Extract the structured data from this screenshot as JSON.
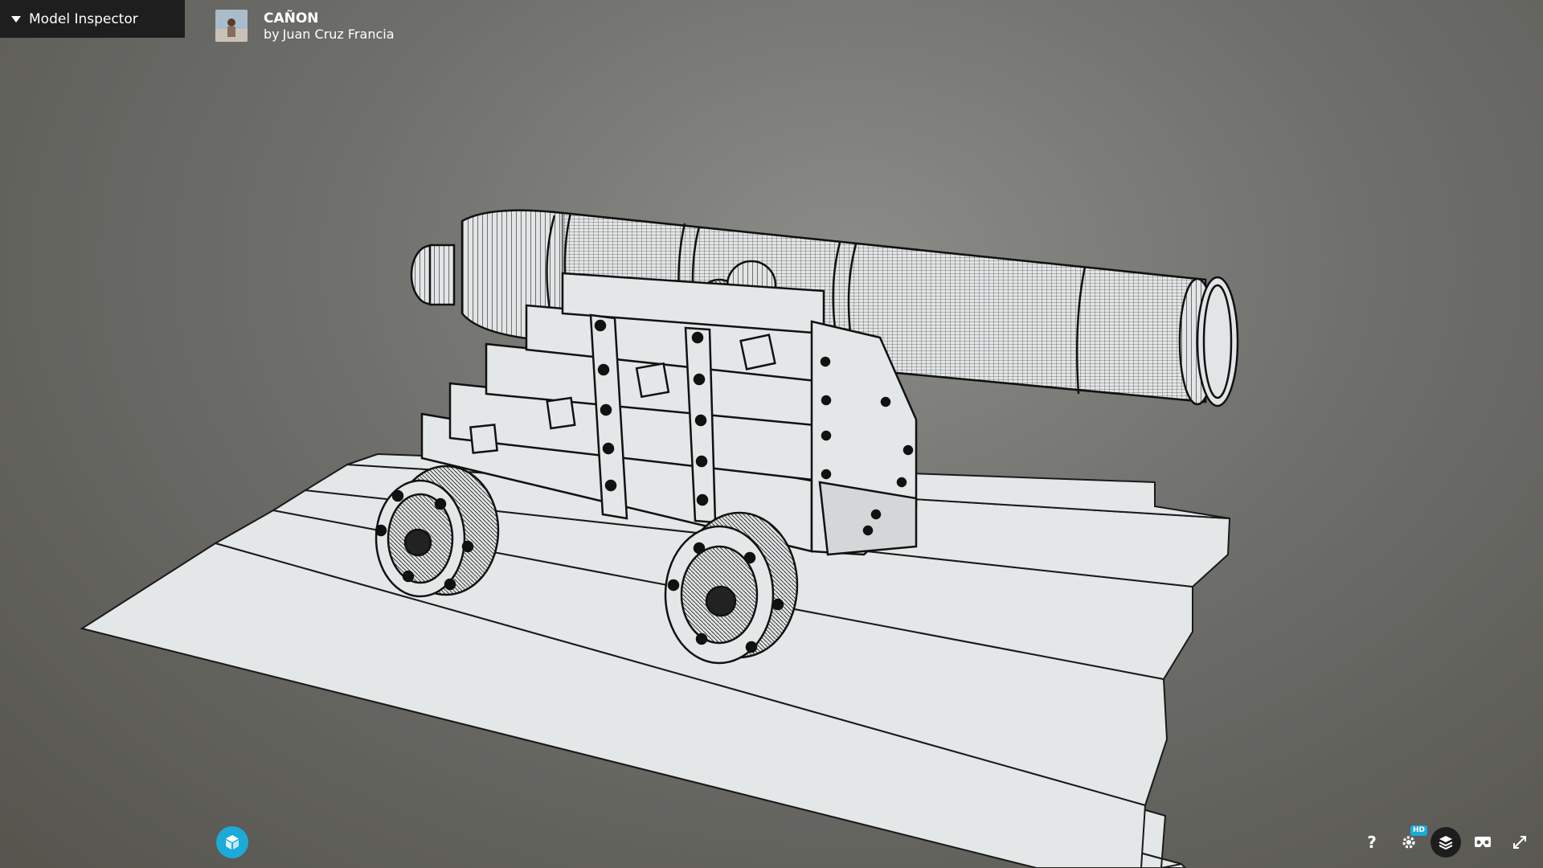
{
  "inspector": {
    "label": "Model Inspector"
  },
  "model": {
    "title": "CAÑON",
    "author_prefix": "by",
    "author": "Juan Cruz Francia"
  },
  "controls": {
    "help_label": "?",
    "settings_badge": "HD",
    "icons": [
      "help-icon",
      "settings-icon",
      "layers-icon",
      "vr-icon",
      "fullscreen-icon"
    ]
  },
  "colors": {
    "accent": "#1caad9",
    "panel": "#1e1e1e",
    "mesh": "#dfe3e3",
    "wire": "#111111"
  }
}
